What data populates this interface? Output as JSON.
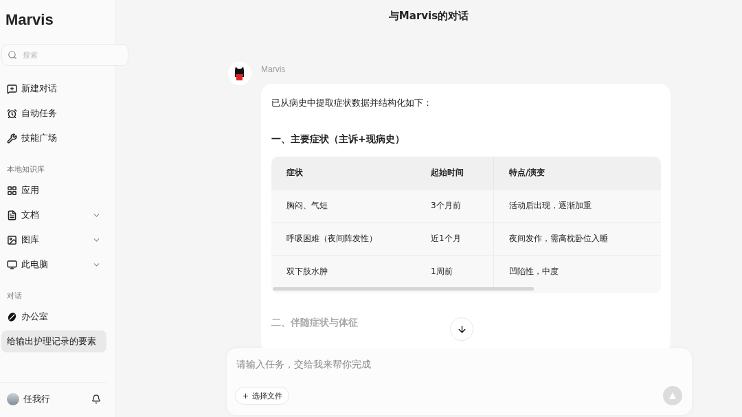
{
  "header": {
    "title": "与Marvis的对话"
  },
  "sidebar": {
    "logo": "Marvis",
    "search": {
      "placeholder": "搜索"
    },
    "nav": [
      {
        "label": "新建对话"
      },
      {
        "label": "自动任务"
      },
      {
        "label": "技能广场"
      }
    ],
    "knowledge": {
      "title": "本地知识库",
      "items": [
        {
          "label": "应用",
          "kind": "link"
        },
        {
          "label": "文档",
          "kind": "folder",
          "expanded": false
        },
        {
          "label": "图库",
          "kind": "folder",
          "expanded": false
        },
        {
          "label": "此电脑",
          "kind": "folder",
          "expanded": false
        }
      ]
    },
    "chats": {
      "title": "对话",
      "items": [
        {
          "label": "办公室",
          "kind": "room",
          "selected": false
        },
        {
          "label": "给输出护理记录的要素",
          "kind": "chat",
          "selected": true
        }
      ]
    },
    "user": {
      "name": "任我行"
    }
  },
  "message": {
    "sender": "Marvis",
    "intro": "已从病史中提取症状数据并结构化如下：",
    "sections": [
      {
        "heading": "一、主要症状（主诉+现病史）",
        "table": {
          "columns": [
            "症状",
            "起始时间",
            "特点/演变"
          ],
          "rows": [
            [
              "胸闷、气短",
              "3个月前",
              "活动后出现，逐渐加重"
            ],
            [
              "呼吸困难（夜间阵发性）",
              "近1个月",
              "夜间发作，需高枕卧位入睡"
            ],
            [
              "双下肢水肿",
              "1周前",
              "凹陷性，中度"
            ]
          ]
        }
      },
      {
        "heading": "二、伴随症状与体征"
      }
    ]
  },
  "input": {
    "placeholder": "请输入任务，交给我来帮你完成",
    "attach_button": "选择文件",
    "send": {
      "disabled": true
    }
  }
}
